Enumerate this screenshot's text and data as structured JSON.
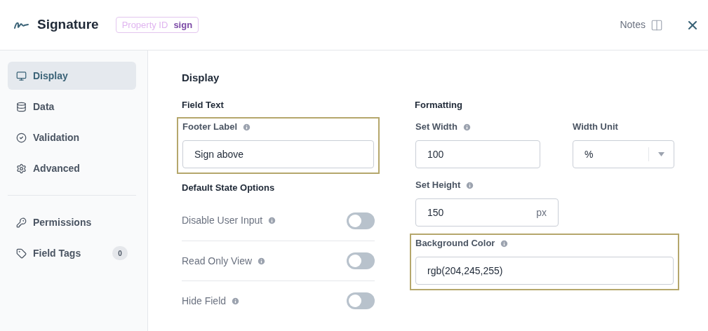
{
  "header": {
    "title": "Signature",
    "property_id_label": "Property ID",
    "property_id_value": "sign",
    "notes_label": "Notes"
  },
  "sidebar": {
    "primary_items": [
      {
        "label": "Display",
        "selected": true
      },
      {
        "label": "Data",
        "selected": false
      },
      {
        "label": "Validation",
        "selected": false
      },
      {
        "label": "Advanced",
        "selected": false
      }
    ],
    "secondary_items": [
      {
        "label": "Permissions",
        "selected": false
      },
      {
        "label": "Field Tags",
        "selected": false,
        "badge": "0"
      }
    ]
  },
  "content": {
    "title": "Display",
    "field_text": {
      "heading": "Field Text",
      "footer_label": {
        "label": "Footer Label",
        "value": "Sign above",
        "highlighted": true
      }
    },
    "default_state": {
      "heading": "Default State Options",
      "toggles": [
        {
          "label": "Disable User Input",
          "on": false
        },
        {
          "label": "Read Only View",
          "on": false
        },
        {
          "label": "Hide Field",
          "on": false
        }
      ]
    },
    "formatting": {
      "heading": "Formatting",
      "set_width": {
        "label": "Set Width",
        "value": "100",
        "highlighted": false
      },
      "width_unit": {
        "label": "Width Unit",
        "value": "%"
      },
      "set_height": {
        "label": "Set Height",
        "value": "150",
        "suffix": "px",
        "highlighted": false
      },
      "background_color": {
        "label": "Background Color",
        "value": "rgb(204,245,255)",
        "highlighted": true
      }
    }
  }
}
